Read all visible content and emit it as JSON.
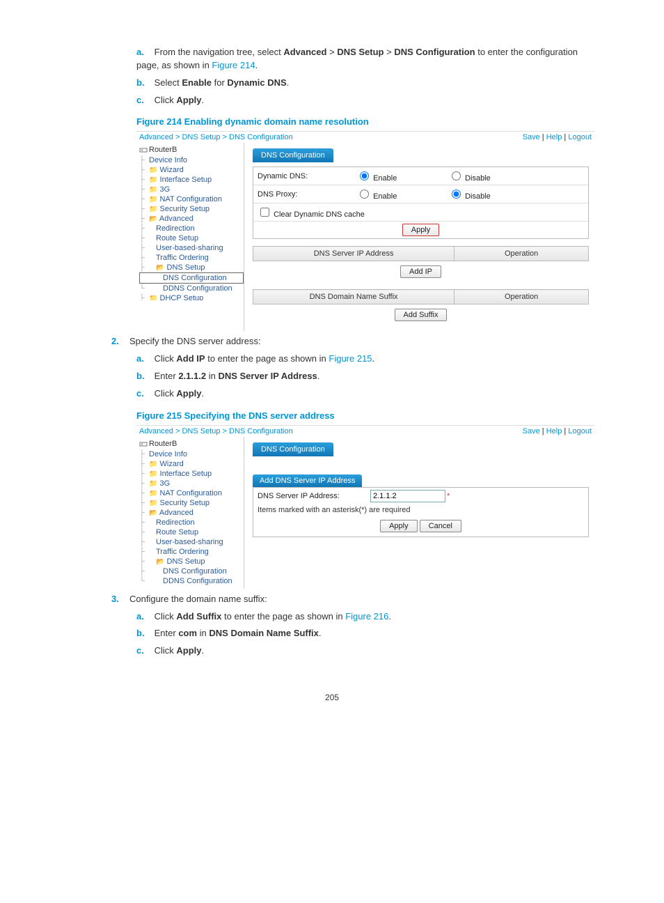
{
  "steps": {
    "s1a_pre": "From the navigation tree, select ",
    "s1a_b1": "Advanced",
    "gt": " > ",
    "s1a_b2": "DNS Setup",
    "s1a_b3": "DNS Configuration",
    "s1a_post": " to enter the configuration page, as shown in ",
    "fig214_link": "Figure 214",
    "period": ".",
    "s1b_pre": "Select ",
    "s1b_b1": "Enable",
    "s1b_mid": " for ",
    "s1b_b2": "Dynamic DNS",
    "s1c_pre": "Click ",
    "s1c_b": "Apply",
    "fig214_cap": "Figure 214 Enabling dynamic domain name resolution",
    "s2_text": "Specify the DNS server address:",
    "s2a_pre": "Click ",
    "s2a_b": "Add IP",
    "s2a_mid": " to enter the page as shown in ",
    "fig215_link": "Figure 215",
    "s2b_pre": "Enter ",
    "s2b_b1": "2.1.1.2",
    "s2b_mid": " in ",
    "s2b_b2": "DNS Server IP Address",
    "s2c_pre": "Click ",
    "s2c_b": "Apply",
    "fig215_cap": "Figure 215 Specifying the DNS server address",
    "s3_text": "Configure the domain name suffix:",
    "s3a_pre": "Click ",
    "s3a_b": "Add Suffix",
    "s3a_mid": " to enter the page as shown in ",
    "fig216_link": "Figure 216",
    "s3b_pre": "Enter ",
    "s3b_b1": "com",
    "s3b_mid": " in ",
    "s3b_b2": "DNS Domain Name Suffix",
    "s3c_pre": "Click ",
    "s3c_b": "Apply"
  },
  "shot1": {
    "breadcrumb": "Advanced > DNS Setup > DNS Configuration",
    "save": "Save",
    "help": "Help",
    "logout": "Logout",
    "root": "RouterB",
    "nav": {
      "device_info": "Device Info",
      "wizard": "Wizard",
      "interface": "Interface Setup",
      "g3": "3G",
      "nat": "NAT Configuration",
      "security": "Security Setup",
      "advanced": "Advanced",
      "redirection": "Redirection",
      "route": "Route Setup",
      "ubs": "User-based-sharing",
      "traffic": "Traffic Ordering",
      "dns": "DNS Setup",
      "dnsconf": "DNS Configuration",
      "ddns": "DDNS Configuration",
      "dhcp": "DHCP Setup"
    },
    "tab": "DNS Configuration",
    "row1": "Dynamic DNS:",
    "enable": "Enable",
    "disable": "Disable",
    "row2": "DNS Proxy:",
    "clear": "Clear Dynamic DNS cache",
    "apply": "Apply",
    "col_ip": "DNS Server IP Address",
    "col_op": "Operation",
    "addip": "Add IP",
    "col_suffix": "DNS Domain Name Suffix",
    "addsuf": "Add Suffix"
  },
  "shot2": {
    "breadcrumb": "Advanced > DNS Setup > DNS Configuration",
    "save": "Save",
    "help": "Help",
    "logout": "Logout",
    "root": "RouterB",
    "nav": {
      "device_info": "Device Info",
      "wizard": "Wizard",
      "interface": "Interface Setup",
      "g3": "3G",
      "nat": "NAT Configuration",
      "security": "Security Setup",
      "advanced": "Advanced",
      "redirection": "Redirection",
      "route": "Route Setup",
      "ubs": "User-based-sharing",
      "traffic": "Traffic Ordering",
      "dns": "DNS Setup",
      "dnsconf": "DNS Configuration",
      "ddns": "DDNS Configuration"
    },
    "tab": "DNS Configuration",
    "subhead": "Add DNS Server IP Address",
    "label": "DNS Server IP Address:",
    "value": "2.1.1.2",
    "asterisk": "*",
    "note": "Items marked with an asterisk(*) are required",
    "apply": "Apply",
    "cancel": "Cancel"
  },
  "page": "205"
}
